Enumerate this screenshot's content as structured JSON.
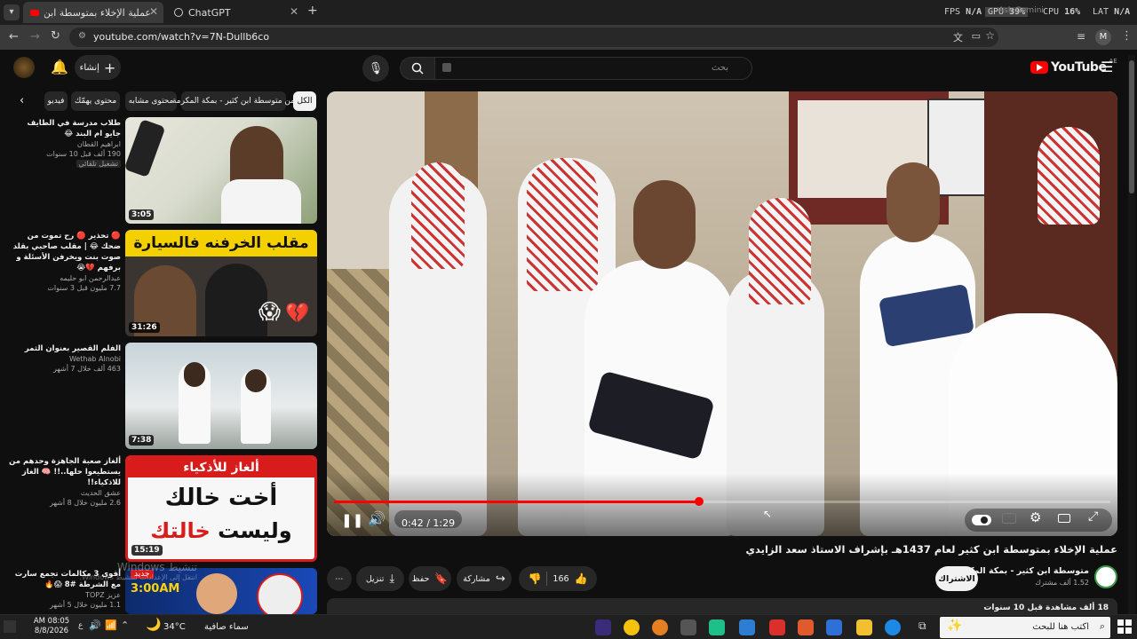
{
  "browser": {
    "tabs": [
      {
        "title": "عملية الإخلاء بمتوسطة ابن كثير",
        "active": true
      },
      {
        "title": "ChatGPT",
        "active": false
      }
    ],
    "new_tab": "+",
    "url": "youtube.com/watch?v=7N-Dullb6co",
    "profile_initial": "M"
  },
  "hud": {
    "fps_label": "FPS",
    "fps_value": "N/A",
    "gpu_label": "GPU",
    "gpu_value": "39%",
    "gpu_overlay": "Ask Gemini",
    "cpu_label": "CPU",
    "cpu_value": "16%",
    "lat_label": "LAT",
    "lat_value": "N/A"
  },
  "youtube": {
    "logo_text": "YouTube",
    "region": "AE",
    "search_placeholder": "بحث",
    "create_label": "إنشاء"
  },
  "chips": [
    {
      "label": "الكل",
      "active": true
    },
    {
      "label": "من متوسطة ابن كثير - بمكة المكرمة"
    },
    {
      "label": "محتوى مشابه"
    },
    {
      "label": "محتوى يهمّك"
    },
    {
      "label": "فيديو"
    }
  ],
  "related": [
    {
      "title": "طلاب مدرسة في الطايف جايو ام البند 😂",
      "channel": "ابراهيم القطان",
      "meta": "190 ألف  قبل 10 سنوات",
      "badge": "تشغيل تلقائي",
      "duration": "3:05"
    },
    {
      "title": "🔴 تحذير 🔴 رح تموت من ضحك 😂 | مقلب صاحبي بقلد صوت بنت ويخرفن الأسئلة و برفهم 💔😭",
      "channel": "عبدالرحمن ابو حليمه",
      "meta": "7.7 مليون  قبل 3 سنوات",
      "duration": "31:26",
      "thumb_text": "مقلب الخرفنه فالسيارة"
    },
    {
      "title": "الفلم القصير بعنوان الثمر",
      "channel": "Wethab Alnobi",
      "meta": "463 ألف  خلال 7 أشهر",
      "duration": "7:38"
    },
    {
      "title": "ألغاز صعبة الجاهزة وحدهم من يستطيعوا حلها..!! 🧠 الغاز للاذكياء!!",
      "channel": "عشق الحديث",
      "meta": "2.6 مليون  خلال 8 أشهر",
      "duration": "15:19",
      "thumb_header": "ألغاز للأذكياء",
      "thumb_line1": "أخت خالك",
      "thumb_line2": "وليست",
      "thumb_line3": "خالتك"
    },
    {
      "title": "أقوى 3 مكالمات تجمع سارت مع الشرطة #8 😱🔥",
      "channel": "عزيز TOPZ",
      "meta": "1.1 مليون  خلال 5 أشهر",
      "thumb_badge": "جديد",
      "thumb_time": "3:00AM"
    }
  ],
  "player": {
    "time": "0:42 / 1:29",
    "progress": 0.47
  },
  "video": {
    "title": "عملية الإخلاء بمتوسطة ابن كثير لعام 1437هـ بإشراف الاستاذ سعد الزايدي",
    "channel": "متوسطة ابن كثير - بمكة المكرمة",
    "subscribers": "1.52 ألف مشترك",
    "subscribe_label": "الاشتراك",
    "likes": "166",
    "share_label": "مشاركة",
    "save_label": "حفظ",
    "download_label": "تنزيل",
    "views": "18 ألف مشاهدة  قبل 10 سنوات"
  },
  "watermark": {
    "line1": "تنشيط Windows",
    "line2": "انتقل إلى الإعدادات لتنشيط Windows."
  },
  "taskbar": {
    "time": "AM 08:05",
    "date": "8/8/2026",
    "weather_temp": "34°C",
    "weather_desc": "سماء صافية",
    "search_placeholder": "اكتب هنا للبحث"
  }
}
